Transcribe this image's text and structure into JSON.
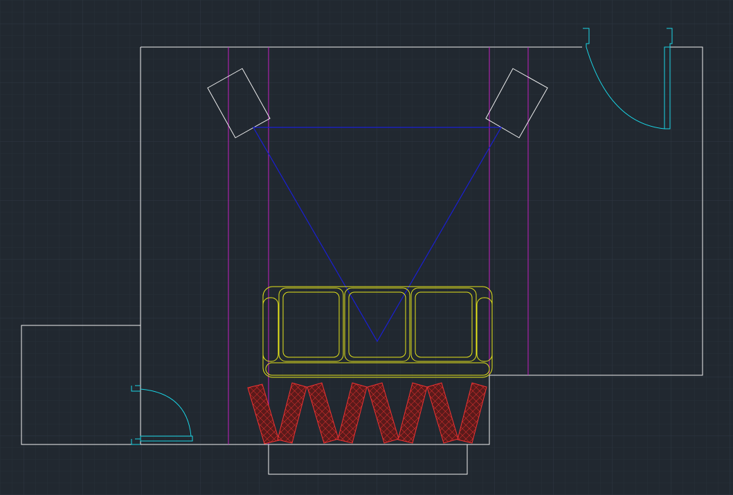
{
  "app": {
    "view": "cad-model-space-plan"
  },
  "colors": {
    "background": "#212830",
    "grid_minor": "#283039",
    "grid_major": "#2f3944",
    "walls": "#f2f2f2",
    "doors": "#1ad6e6",
    "speakers": "#f2f2f2",
    "guide_lines": "#c21fc2",
    "listening_triangle": "#1a1fd6",
    "sofa": "#e6e61a",
    "acoustic_panel_outline": "#f23333",
    "acoustic_panel_fill": "#5a1a1a"
  },
  "layers": [
    {
      "name": "walls",
      "color_key": "walls"
    },
    {
      "name": "doors",
      "color_key": "doors"
    },
    {
      "name": "speakers",
      "color_key": "speakers"
    },
    {
      "name": "guides",
      "color_key": "guide_lines"
    },
    {
      "name": "listening-triangle",
      "color_key": "listening_triangle"
    },
    {
      "name": "sofa",
      "color_key": "sofa"
    },
    {
      "name": "acoustic-panels",
      "color_key": "acoustic_panel_outline"
    }
  ],
  "acoustic_panels": {
    "count": 8,
    "hatch": "cross"
  },
  "sofa": {
    "seat_cushions": 3
  }
}
